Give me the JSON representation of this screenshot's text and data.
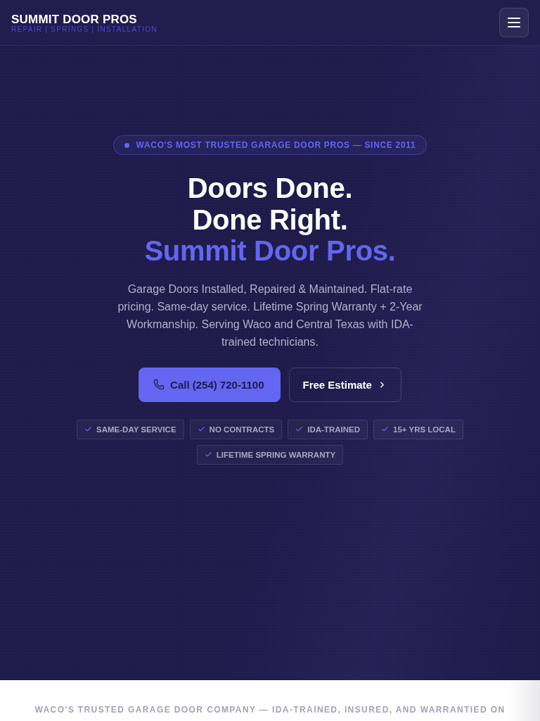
{
  "header": {
    "logo": "SUMMIT DOOR PROS",
    "tagline": "REPAIR | SPRINGS | INSTALLATION"
  },
  "hero": {
    "badge": "WACO'S MOST TRUSTED GARAGE DOOR PROS — SINCE 2011",
    "headline": [
      "Doors Done.",
      "Done Right."
    ],
    "headline_accent": "Summit Door Pros.",
    "description": "Garage Doors Installed, Repaired & Maintained. Flat-rate pricing. Same-day service. Lifetime Spring Warranty + 2-Year Workmanship. Serving Waco and Central Texas with IDA-trained technicians.",
    "buttons": [
      {
        "label": "Call (254) 720-1100",
        "kind": "primary"
      },
      {
        "label": "Free Estimate",
        "kind": "secondary"
      }
    ],
    "features": [
      "SAME-DAY SERVICE",
      "NO CONTRACTS",
      "IDA-TRAINED",
      "15+ YRS LOCAL",
      "LIFETIME SPRING WARRANTY"
    ]
  },
  "trust_strip": {
    "text": "WACO'S TRUSTED GARAGE DOOR COMPANY — IDA-TRAINED, INSURED, AND WARRANTIED ON"
  }
}
